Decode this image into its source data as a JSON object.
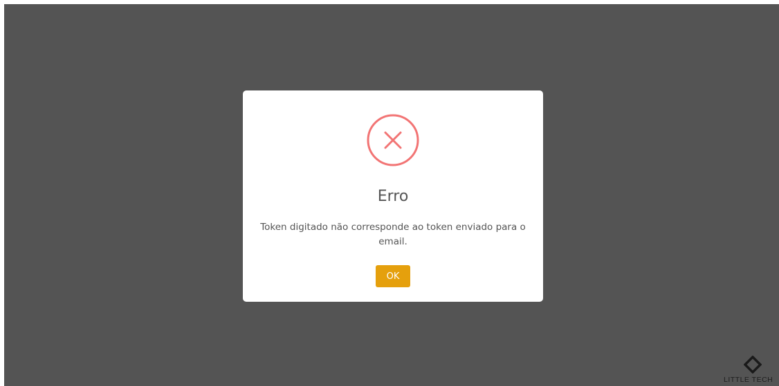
{
  "dialog": {
    "title": "Erro",
    "message": "Token digitado não corresponde ao token enviado para o email.",
    "ok_label": "OK",
    "icon": "error-x-circle-icon"
  },
  "brand": {
    "name": "LITTLE TECH"
  },
  "colors": {
    "overlay": "#545454",
    "error_icon": "#f27474",
    "button": "#e5a00d",
    "text": "#545454"
  }
}
